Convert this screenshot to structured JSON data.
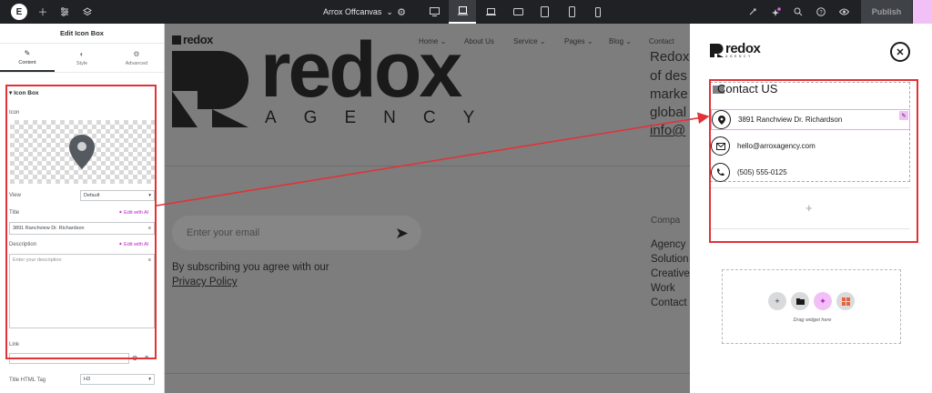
{
  "topbar": {
    "document_title": "Arrox Offcanvas",
    "publish_label": "Publish",
    "left_icons": [
      "elementor-logo-icon",
      "add-icon",
      "settings-sliders-icon",
      "layers-icon"
    ],
    "devices": [
      "desktop-icon",
      "laptop-icon",
      "tablet-landscape-icon",
      "tablet-icon",
      "mobile-landscape-icon",
      "mobile-icon"
    ],
    "right_icons": [
      "ai-icon",
      "notifications-icon",
      "search-icon",
      "help-icon",
      "preview-icon"
    ]
  },
  "panel": {
    "title": "Edit Icon Box",
    "tabs": [
      {
        "label": "Content",
        "icon": "pencil-icon"
      },
      {
        "label": "Style",
        "icon": "half-circle-icon"
      },
      {
        "label": "Advanced",
        "icon": "gear-icon"
      }
    ],
    "section_title": "Icon Box",
    "icon_label": "Icon",
    "view_label": "View",
    "view_value": "Default",
    "title_label": "Title",
    "title_value": "3891 Ranchview Dr. Richardson",
    "edit_with_ai": "Edit with AI",
    "description_label": "Description",
    "description_placeholder": "Enter your description",
    "link_label": "Link",
    "title_tag_label": "Title HTML Tag",
    "title_tag_value": "H3"
  },
  "canvas": {
    "brand_small": "redox",
    "brand_big": "redox",
    "brand_sub": "AGENCY",
    "nav": [
      "Home",
      "About Us",
      "Service",
      "Pages",
      "Blog",
      "Contact"
    ],
    "side_lines": [
      "Redox",
      "of des",
      "marke",
      "global",
      "info@"
    ],
    "email_placeholder": "Enter your email",
    "subscribe_line1": "By subscribing you agree with our",
    "subscribe_line2": "Privacy Policy",
    "company_heading": "Compa",
    "company_links": [
      "Agency",
      "Solution",
      "Creative",
      "Work",
      "Contact"
    ]
  },
  "offcanvas": {
    "logo_text": "redox",
    "logo_sub": "AGENCY",
    "contact_title": "Contact US",
    "contacts": [
      {
        "icon": "map-pin-icon",
        "text": "3891 Ranchview Dr. Richardson"
      },
      {
        "icon": "envelope-icon",
        "text": "hello@arroxagency.com"
      },
      {
        "icon": "phone-icon",
        "text": "(505) 555-0125"
      }
    ],
    "drag_label": "Drag widget here"
  },
  "colors": {
    "annotation_red": "#e23237",
    "ai_purple": "#b423c7",
    "topbar": "#1f2124"
  }
}
